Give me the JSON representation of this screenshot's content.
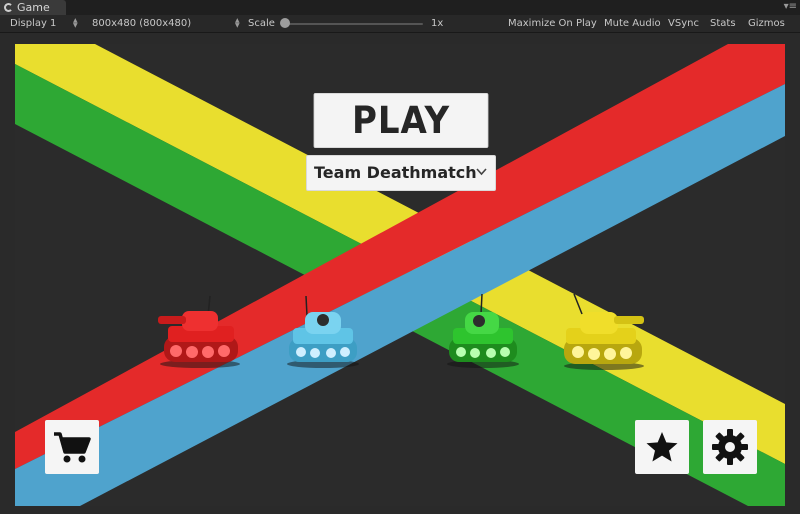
{
  "tab": {
    "title": "Game"
  },
  "toolbar": {
    "display": "Display 1",
    "resolution": "800x480 (800x480)",
    "scale_label": "Scale",
    "scale_value": "1x",
    "maximize": "Maximize On Play",
    "mute": "Mute Audio",
    "vsync": "VSync",
    "stats": "Stats",
    "gizmos": "Gizmos"
  },
  "game": {
    "play_label": "PLAY",
    "mode_selected": "Team Deathmatch",
    "stripe_colors": {
      "yellow": "#e9de2e",
      "green": "#2ea834",
      "red": "#e42a2a",
      "blue": "#4fa3cd"
    },
    "tanks": [
      {
        "name": "red-tank",
        "color": "#e02020"
      },
      {
        "name": "blue-tank",
        "color": "#5fc4e6"
      },
      {
        "name": "green-tank",
        "color": "#2ec42e"
      },
      {
        "name": "yellow-tank",
        "color": "#e4d11a"
      }
    ],
    "buttons": [
      "shop",
      "favorites",
      "settings"
    ]
  }
}
